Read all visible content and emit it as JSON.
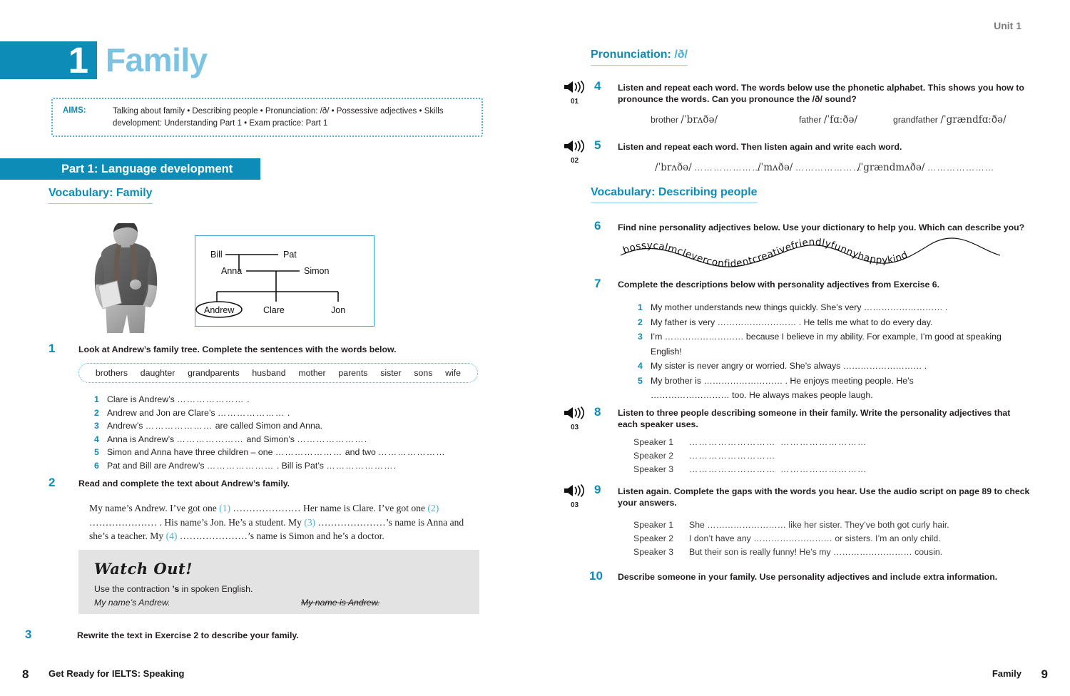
{
  "colors": {
    "teal": "#0d8cb8",
    "light_blue": "#7cc3e3",
    "accent_rule": "#8dd0e8",
    "grey_box": "#e3e3e3",
    "unit_tag_grey": "#7d7d7d"
  },
  "left_page": {
    "unit_number": "1",
    "unit_title": "Family",
    "aims": {
      "label": "AIMS:",
      "text": "Talking about family • Describing people • Pronunciation: /ð/ • Possessive adjectives • Skills development: Understanding Part 1 • Exam practice: Part 1"
    },
    "part_banner": "Part 1: Language development",
    "vocab_heading": "Vocabulary: Family",
    "family_tree": {
      "generation1": [
        "Bill",
        "Pat"
      ],
      "generation2": [
        "Anna",
        "Simon"
      ],
      "generation3": [
        "Andrew",
        "Clare",
        "Jon"
      ],
      "circled": "Andrew"
    },
    "exercise1": {
      "number": "1",
      "instruction": "Look at Andrew’s family tree. Complete the sentences with the words below.",
      "wordbank": [
        "brothers",
        "daughter",
        "grandparents",
        "husband",
        "mother",
        "parents",
        "sister",
        "sons",
        "wife"
      ],
      "items": [
        {
          "n": "1",
          "text_before": "Clare is Andrew’s",
          "dots1": "…………………",
          "text_mid": ".",
          "dots2": "",
          "text_after": ""
        },
        {
          "n": "2",
          "text_before": "Andrew and Jon are Clare’s",
          "dots1": "…………………",
          "text_mid": ".",
          "dots2": "",
          "text_after": ""
        },
        {
          "n": "3",
          "text_before": "Andrew’s",
          "dots1": "…………………",
          "text_mid": "are called Simon and Anna.",
          "dots2": "",
          "text_after": ""
        },
        {
          "n": "4",
          "text_before": "Anna is Andrew’s",
          "dots1": "…………………",
          "text_mid": "and Simon’s",
          "dots2": "…………………",
          "text_after": "."
        },
        {
          "n": "5",
          "text_before": "Simon and Anna have three children – one",
          "dots1": "…………………",
          "text_mid": "and two",
          "dots2": "…………………",
          "text_after": ""
        },
        {
          "n": "6",
          "text_before": "Pat and Bill are Andrew’s",
          "dots1": "…………………",
          "text_mid": ". Bill is Pat’s",
          "dots2": "…………………",
          "text_after": "."
        }
      ]
    },
    "exercise2": {
      "number": "2",
      "instruction": "Read and complete the text about Andrew’s family.",
      "passage_line1_a": "My name’s Andrew. I’ve got one ",
      "passage_gap1": "(1)",
      "passage_line1_b": " ………………… Her name is Clare. I’ve got one ",
      "passage_gap2": "(2)",
      "passage_line2_a": " ………………… . His name’s Jon. He’s a student. My ",
      "passage_gap3": "(3)",
      "passage_line2_b": " …………………’s name is Anna and she’s a teacher. My ",
      "passage_gap4": "(4)",
      "passage_line3": " …………………’s name is Simon and he’s a doctor."
    },
    "watch_out": {
      "title": "Watch Out!",
      "line": "Use the contraction ’s in spoken English.",
      "line_bold_part": "’s",
      "correct_example": "My name’s Andrew.",
      "wrong_example": "My name is Andrew."
    },
    "exercise3": {
      "number": "3",
      "instruction": "Rewrite the text in Exercise 2 to describe your family."
    },
    "footer": {
      "page_number": "8",
      "book_title": "Get Ready for IELTS: Speaking"
    }
  },
  "right_page": {
    "unit_tag": "Unit 1",
    "pronunciation_heading_a": "Pronunciation: ",
    "pronunciation_heading_b": "/ð/",
    "exercise4": {
      "number": "4",
      "track": "01",
      "instruction": "Listen and repeat each word. The words below use the phonetic alphabet. This shows you how to pronounce the words. Can you pronounce the /ð/ sound?",
      "words": [
        {
          "word": "brother",
          "phonetic": "/ˈbrʌðə/"
        },
        {
          "word": "father",
          "phonetic": "/ˈfɑːðə/"
        },
        {
          "word": "grandfather",
          "phonetic": "/ˈgrændfɑːðə/"
        }
      ]
    },
    "exercise5": {
      "number": "5",
      "track": "02",
      "instruction": "Listen and repeat each word. Then listen again and write each word.",
      "items": [
        {
          "phonetic": "/ˈbrʌðə/",
          "dots": "…………………"
        },
        {
          "phonetic": "/ˈmʌðə/",
          "dots": "…………………"
        },
        {
          "phonetic": "/ˈgrændmʌðə/",
          "dots": "…………………"
        }
      ]
    },
    "vocab_heading": "Vocabulary: Describing people",
    "exercise6": {
      "number": "6",
      "instruction": "Find nine personality adjectives below. Use your dictionary to help you. Which can describe you?",
      "wave_text": "bossycalmcleverconfidentcreativefriendlyfunnyhappykind",
      "hidden_adjectives": [
        "bossy",
        "calm",
        "clever",
        "confident",
        "creative",
        "friendly",
        "funny",
        "happy",
        "kind"
      ]
    },
    "exercise7": {
      "number": "7",
      "instruction": "Complete the descriptions below with personality adjectives from Exercise 6.",
      "items": [
        {
          "n": "1",
          "text": "My mother understands new things quickly. She’s very ……………………… ."
        },
        {
          "n": "2",
          "text": "My father is very ……………………… . He tells me what to do every day."
        },
        {
          "n": "3",
          "text": "I’m ……………………… because I believe in my ability. For example, I’m good at speaking English!"
        },
        {
          "n": "4",
          "text": "My sister is never angry or worried. She’s always ……………………… ."
        },
        {
          "n": "5",
          "text": "My brother is ……………………… . He enjoys meeting people. He’s ……………………… too. He always makes people laugh."
        }
      ]
    },
    "exercise8": {
      "number": "8",
      "track": "03",
      "instruction": "Listen to three people describing someone in their family. Write the personality adjectives that each speaker uses.",
      "rows": [
        {
          "label": "Speaker 1",
          "blank1": "………………………",
          "blank2": "………………………"
        },
        {
          "label": "Speaker 2",
          "blank1": "………………………",
          "blank2": ""
        },
        {
          "label": "Speaker 3",
          "blank1": "………………………",
          "blank2": "………………………"
        }
      ]
    },
    "exercise9": {
      "number": "9",
      "track": "03",
      "instruction": "Listen again. Complete the gaps with the words you hear. Use the audio script on page 89 to check your answers.",
      "rows": [
        {
          "label": "Speaker 1",
          "text": "She ……………………… like her sister. They’ve both got curly hair."
        },
        {
          "label": "Speaker 2",
          "text": "I don’t have any ……………………… or sisters. I’m an only child."
        },
        {
          "label": "Speaker 3",
          "text": "But their son is really funny! He’s my ……………………… cousin."
        }
      ]
    },
    "exercise10": {
      "number": "10",
      "instruction": "Describe someone in your family. Use personality adjectives and include extra information."
    },
    "footer": {
      "page_number": "9",
      "unit_name": "Family"
    }
  }
}
